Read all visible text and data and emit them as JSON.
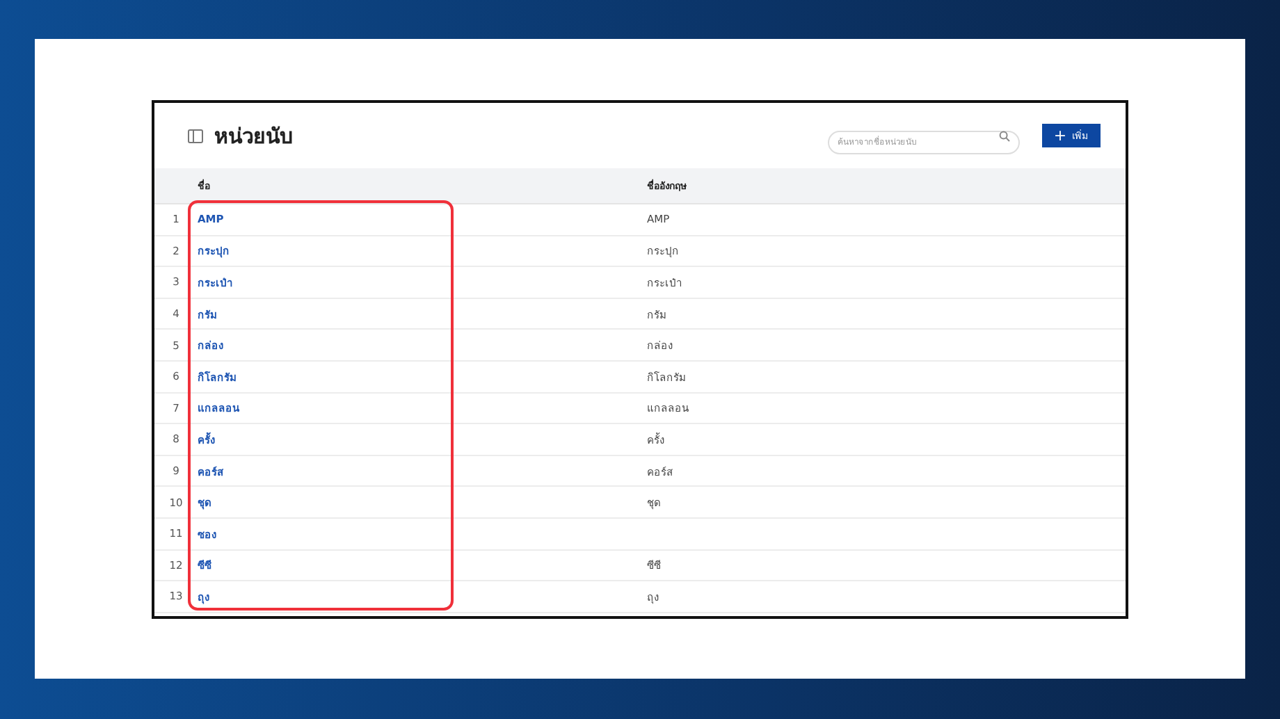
{
  "page": {
    "title": "หน่วยนับ"
  },
  "search": {
    "placeholder": "ค้นหาจากชื่อหน่วยนับ"
  },
  "add_button": {
    "label": "เพิ่ม",
    "icon": "+"
  },
  "table": {
    "columns": [
      "ชื่อ",
      "ชื่ออังกฤษ"
    ],
    "rows": [
      {
        "index": "1",
        "name": "AMP",
        "english_name": "AMP"
      },
      {
        "index": "2",
        "name": "กระปุก",
        "english_name": "กระปุก"
      },
      {
        "index": "3",
        "name": "กระเป๋า",
        "english_name": "กระเป๋า"
      },
      {
        "index": "4",
        "name": "กรัม",
        "english_name": "กรัม"
      },
      {
        "index": "5",
        "name": "กล่อง",
        "english_name": "กล่อง"
      },
      {
        "index": "6",
        "name": "กิโลกรัม",
        "english_name": "กิโลกรัม"
      },
      {
        "index": "7",
        "name": "แกลลอน",
        "english_name": "แกลลอน"
      },
      {
        "index": "8",
        "name": "ครั้ง",
        "english_name": "ครั้ง"
      },
      {
        "index": "9",
        "name": "คอร์ส",
        "english_name": "คอร์ส"
      },
      {
        "index": "10",
        "name": "ชุด",
        "english_name": "ชุด"
      },
      {
        "index": "11",
        "name": "ซอง"
      },
      {
        "index": "12",
        "name": "ซีซี",
        "english_name": "ซีซี"
      },
      {
        "index": "13",
        "name": "ถุง",
        "english_name": "ถุง"
      }
    ]
  }
}
